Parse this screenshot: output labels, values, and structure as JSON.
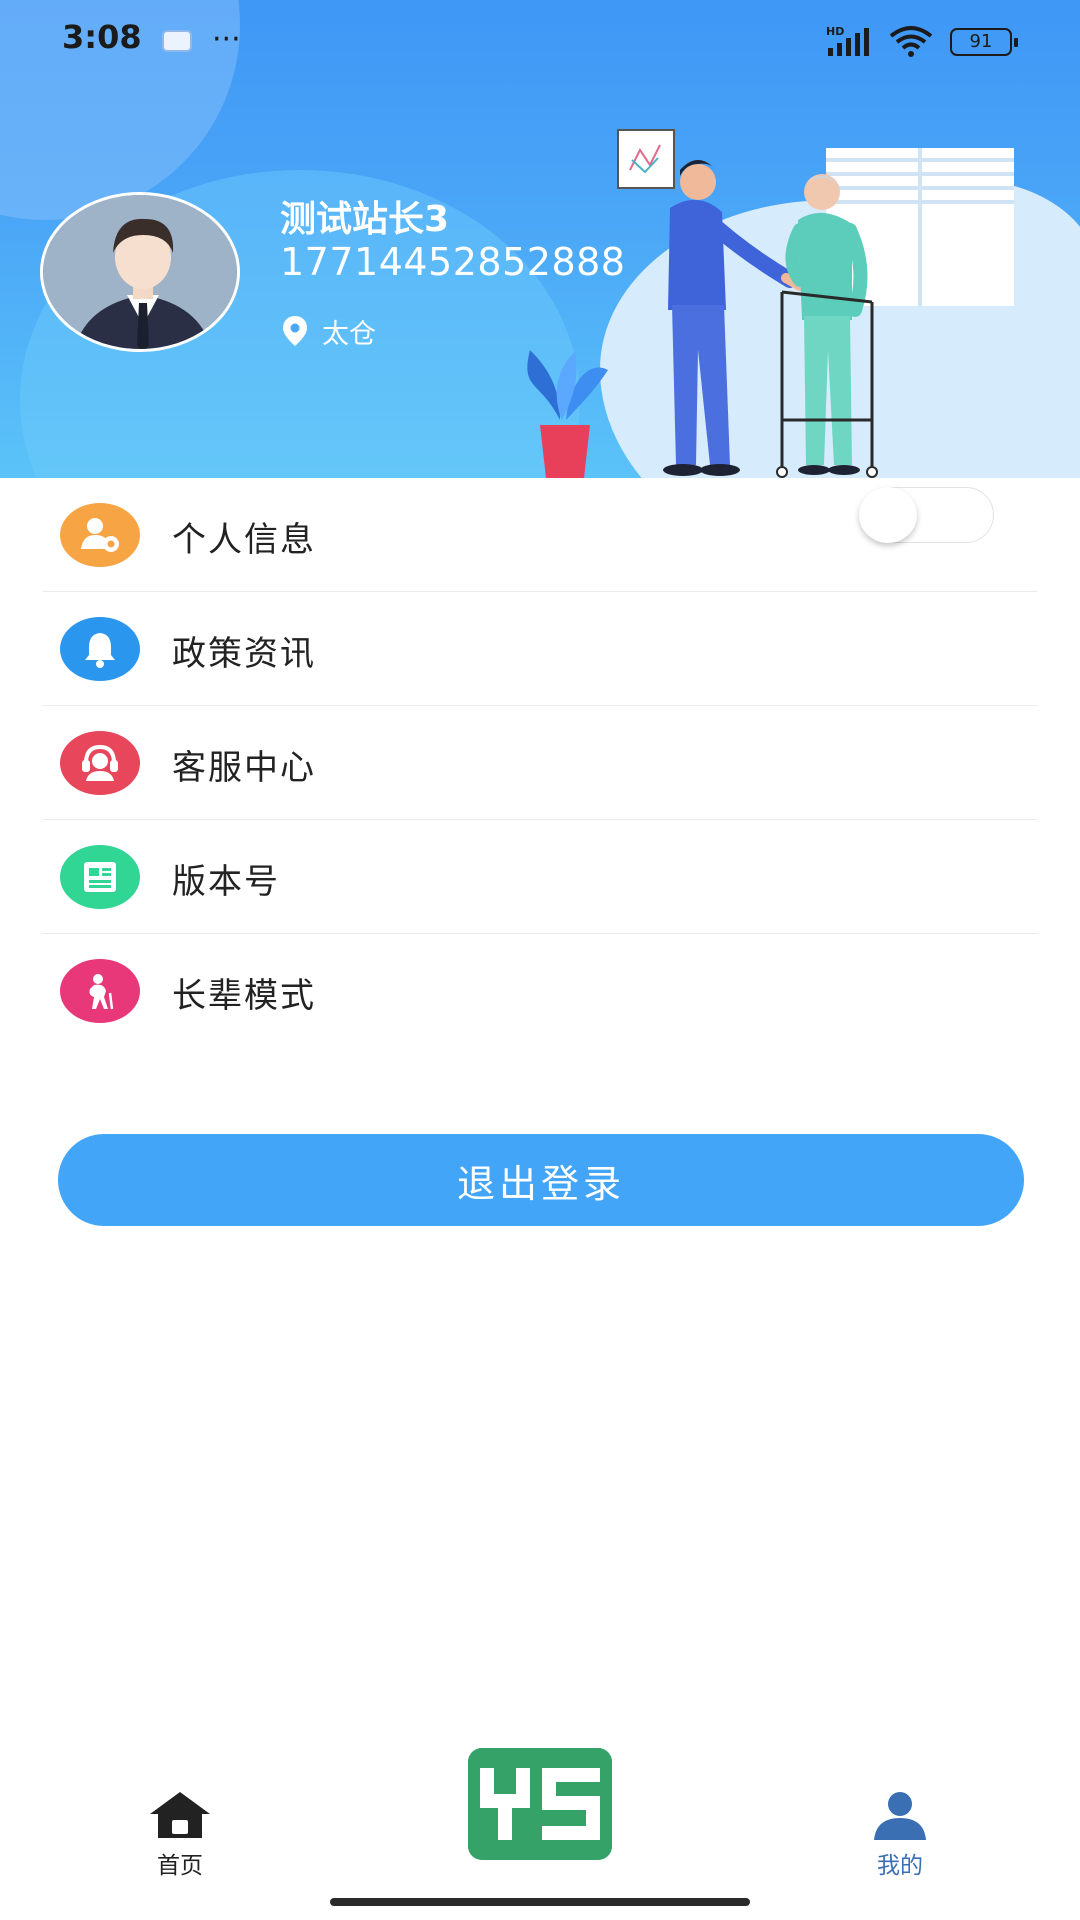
{
  "status_bar": {
    "time": "3:08",
    "more": "···",
    "battery": "91"
  },
  "profile": {
    "name": "测试站长3",
    "phone": "17714452852888",
    "location": "太仓"
  },
  "menu": {
    "items": [
      {
        "label": "个人信息",
        "icon": "user-settings-icon",
        "color": "#f7a444"
      },
      {
        "label": "政策资讯",
        "icon": "bell-icon",
        "color": "#2a96ee"
      },
      {
        "label": "客服中心",
        "icon": "headset-icon",
        "color": "#e8465a"
      },
      {
        "label": "版本号",
        "icon": "document-icon",
        "color": "#31d594"
      },
      {
        "label": "长辈模式",
        "icon": "elder-icon",
        "color": "#e8387a"
      }
    ],
    "elder_mode_enabled": false
  },
  "logout": {
    "label": "退出登录"
  },
  "bottom_nav": {
    "home_label": "首页",
    "center_logo_text": "YS",
    "mine_label": "我的"
  },
  "colors": {
    "header": "#3f97f6",
    "accent": "#42a5f7",
    "logo_green": "#35a268",
    "active_tab": "#3b6fb3"
  }
}
